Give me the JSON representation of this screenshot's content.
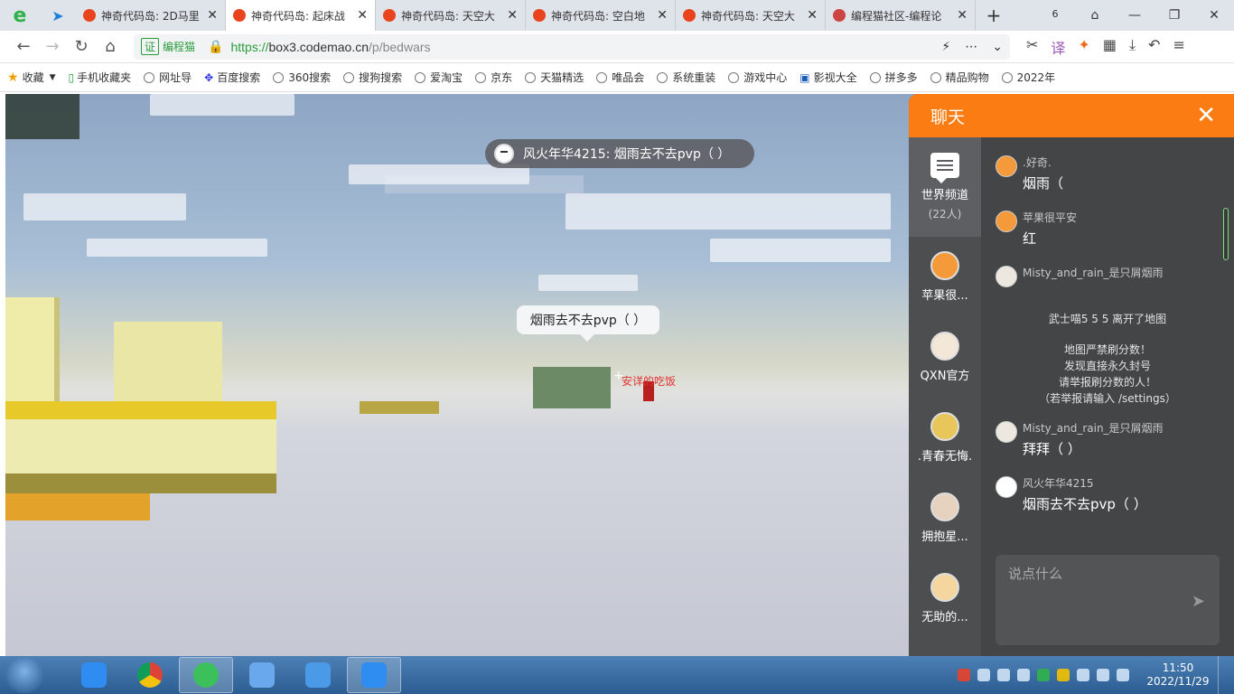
{
  "browser": {
    "tabs": [
      {
        "title": "神奇代码岛: 2D马里",
        "active": false
      },
      {
        "title": "神奇代码岛: 起床战",
        "active": true
      },
      {
        "title": "神奇代码岛: 天空大",
        "active": false
      },
      {
        "title": "神奇代码岛: 空白地",
        "active": false
      },
      {
        "title": "神奇代码岛: 天空大",
        "active": false
      },
      {
        "title": "编程猫社区-编程论",
        "active": false
      }
    ],
    "new_tab": "+",
    "tab_count": "6",
    "cert_badge": "证",
    "cert_name": "编程猫",
    "url_secure_part": "https://",
    "url_host": "box3.codemao.cn",
    "url_path": "/p/bedwars"
  },
  "bookmarks": [
    {
      "label": "收藏",
      "icon": "star-icon"
    },
    {
      "label": "手机收藏夹",
      "icon": "phone-icon"
    },
    {
      "label": "网址导",
      "icon": "globe-icon"
    },
    {
      "label": "百度搜索",
      "icon": "baidu-icon"
    },
    {
      "label": "360搜索",
      "icon": "globe-icon"
    },
    {
      "label": "搜狗搜索",
      "icon": "globe-icon"
    },
    {
      "label": "爱淘宝",
      "icon": "globe-icon"
    },
    {
      "label": "京东",
      "icon": "globe-icon"
    },
    {
      "label": "天猫精选",
      "icon": "globe-icon"
    },
    {
      "label": "唯品会",
      "icon": "globe-icon"
    },
    {
      "label": "系统重装",
      "icon": "globe-icon"
    },
    {
      "label": "游戏中心",
      "icon": "globe-icon"
    },
    {
      "label": "影视大全",
      "icon": "film-icon"
    },
    {
      "label": "拼多多",
      "icon": "globe-icon"
    },
    {
      "label": "精品购物",
      "icon": "globe-icon"
    },
    {
      "label": "2022年",
      "icon": "globe-icon"
    }
  ],
  "game": {
    "player_announcement": "风火年华4215: 烟雨去不去pvp（ ）",
    "speech_bubble": "烟雨去不去pvp（ ）",
    "nametag": "安详的吃饭"
  },
  "chat": {
    "title": "聊天",
    "channel": {
      "label": "世界频道",
      "count": "(22人)"
    },
    "contacts": [
      {
        "label": "苹果很..."
      },
      {
        "label": "QXN官方"
      },
      {
        "label": ".青春无悔."
      },
      {
        "label": "拥抱星..."
      },
      {
        "label": "无助的..."
      }
    ],
    "messages": [
      {
        "name": ".好奇.",
        "text": "烟雨（"
      },
      {
        "name": "苹果很平安",
        "text": "红"
      },
      {
        "name": "Misty_and_rain_是只屑烟雨",
        "text": ""
      }
    ],
    "system_lines": [
      "武士喵5 5 5 离开了地图",
      "",
      "地图严禁刷分数！",
      "发现直接永久封号",
      "请举报刷分数的人！",
      "（若举报请输入 /settings）"
    ],
    "messages_after": [
      {
        "name": "Misty_and_rain_是只屑烟雨",
        "text": "拜拜（ ）"
      },
      {
        "name": "风火年华4215",
        "text": "烟雨去不去pvp（ ）"
      }
    ],
    "input_placeholder": "说点什么"
  },
  "taskbar": {
    "time": "11:50",
    "date": "2022/11/29"
  }
}
